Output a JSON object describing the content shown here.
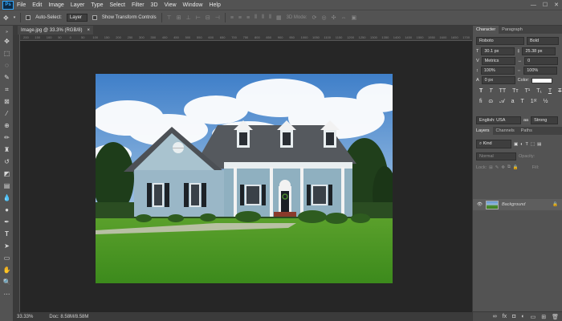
{
  "menu": [
    "File",
    "Edit",
    "Image",
    "Layer",
    "Type",
    "Select",
    "Filter",
    "3D",
    "View",
    "Window",
    "Help"
  ],
  "app_logo": "Ps",
  "window_controls": [
    "—",
    "☐",
    "✕"
  ],
  "options": {
    "auto_select_label": "Auto-Select:",
    "auto_select_value": "Layer",
    "transform_label": "Show Transform Controls",
    "mode_3d_label": "3D Mode:"
  },
  "document": {
    "tab_title": "Image.jpg @ 33.3% (RGB/8)",
    "tab_close": "×"
  },
  "ruler_ticks": [
    "200",
    "150",
    "100",
    "50",
    "0",
    "50",
    "100",
    "150",
    "200",
    "250",
    "300",
    "350",
    "400",
    "450",
    "500",
    "550",
    "600",
    "650",
    "700",
    "750",
    "800",
    "850",
    "900",
    "950",
    "1000",
    "1050",
    "1100",
    "1150",
    "1200",
    "1250",
    "1300",
    "1350",
    "1400",
    "1450",
    "1500",
    "1550",
    "1600",
    "1650",
    "1700"
  ],
  "status": {
    "zoom": "33.33%",
    "doc": "Doc: 8.58M/8.58M"
  },
  "character_panel": {
    "tab_character": "Character",
    "tab_paragraph": "Paragraph",
    "font_family": "Roboto",
    "font_style": "Bold",
    "font_size": "30.1 px",
    "leading": "25.38 px",
    "kerning": "Metrics",
    "tracking": "0",
    "vertical_scale": "100%",
    "horizontal_scale": "100%",
    "baseline_shift": "0 px",
    "color_label": "Color:",
    "language": "English: USA",
    "anti_alias": "Strong",
    "aa_prefix": "aa"
  },
  "layers_panel": {
    "tabs": [
      "Layers",
      "Channels",
      "Paths"
    ],
    "kind_label": "Kind",
    "blend_mode": "Normal",
    "opacity_label": "Opacity:",
    "lock_label": "Lock:",
    "fill_label": "Fill:",
    "layer_name": "Background"
  },
  "colors": {
    "foreground": "#ffffff",
    "background": "#f0772c",
    "accent": "#31a8ff"
  }
}
